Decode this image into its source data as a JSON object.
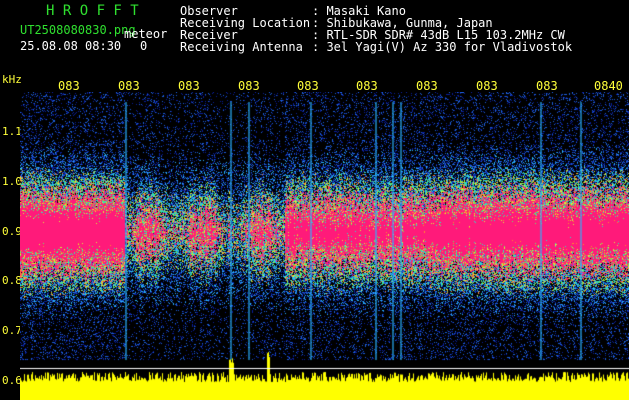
{
  "header": {
    "app_title": "H R O F F T",
    "filename": "UT2508080830.png",
    "meteor_label": "meteor",
    "datetime": "25.08.08 08:30",
    "count": "0"
  },
  "info": [
    {
      "label": "Observer",
      "value": ": Masaki Kano"
    },
    {
      "label": "Receiving Location",
      "value": ": Shibukawa, Gunma, Japan"
    },
    {
      "label": "Receiver",
      "value": ": RTL-SDR SDR# 43dB L15 103.2MHz CW"
    },
    {
      "label": "Receiving Antenna",
      "value": ": 3el Yagi(V) Az 330 for Vladivostok"
    }
  ],
  "axis": {
    "unit": "kHz",
    "freq_labels": [
      "1.1",
      "1.0",
      "0.9",
      "0.8",
      "0.7",
      "0.6"
    ],
    "time_ticks": [
      "083",
      "083",
      "083",
      "083",
      "083",
      "083",
      "083",
      "083",
      "083",
      "0840"
    ]
  },
  "colors": {
    "background": "#000000",
    "green_text": "#2fe02f",
    "yellow_text": "#ffff3a",
    "signal_core": "#ff1a7a",
    "noise_floor": "#ffff00"
  }
}
